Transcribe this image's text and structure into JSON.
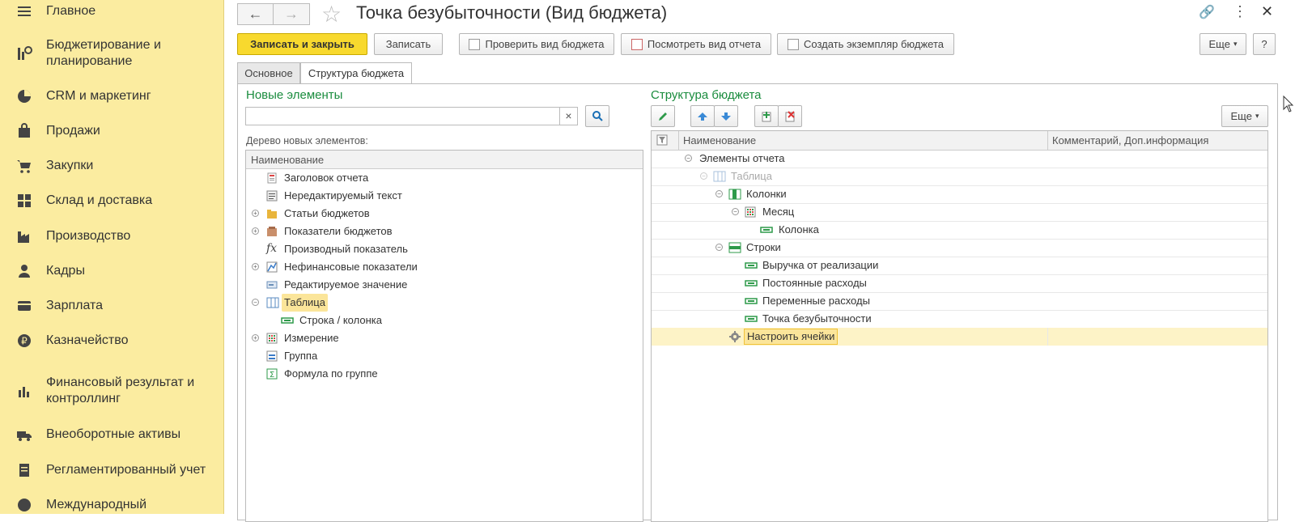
{
  "sidebar": {
    "items": [
      {
        "label": "Главное",
        "icon": "menu-icon"
      },
      {
        "label": "Бюджетирование и планирование",
        "icon": "budget-icon"
      },
      {
        "label": "CRM и маркетинг",
        "icon": "pie-chart-icon"
      },
      {
        "label": "Продажи",
        "icon": "shopping-bag-icon"
      },
      {
        "label": "Закупки",
        "icon": "cart-icon"
      },
      {
        "label": "Склад и доставка",
        "icon": "grid-icon"
      },
      {
        "label": "Производство",
        "icon": "factory-icon"
      },
      {
        "label": "Кадры",
        "icon": "person-icon"
      },
      {
        "label": "Зарплата",
        "icon": "wallet-icon"
      },
      {
        "label": "Казначейство",
        "icon": "ruble-icon"
      },
      {
        "label": "Финансовый результат и контроллинг",
        "icon": "bar-chart-icon"
      },
      {
        "label": "Внеоборотные активы",
        "icon": "truck-icon"
      },
      {
        "label": "Регламентированный учет",
        "icon": "document-icon"
      },
      {
        "label": "Международный",
        "icon": "globe-icon"
      }
    ]
  },
  "header": {
    "title": "Точка безубыточности (Вид бюджета)",
    "back_icon": "←",
    "forward_icon": "→",
    "star_icon": "☆",
    "link_icon": "🔗",
    "more_icon": "⋮",
    "close_icon": "✕"
  },
  "toolbar": {
    "save_close": "Записать и закрыть",
    "save": "Записать",
    "check": "Проверить вид бюджета",
    "view_report": "Посмотреть вид отчета",
    "create_instance": "Создать экземпляр бюджета",
    "more": "Еще",
    "help": "?"
  },
  "tabs": {
    "main": "Основное",
    "structure": "Структура бюджета"
  },
  "left": {
    "title": "Новые элементы",
    "search_value": "",
    "clear": "×",
    "tree_label": "Дерево новых элементов:",
    "column": "Наименование",
    "rows": [
      {
        "label": "Заголовок отчета"
      },
      {
        "label": "Нередактируемый текст"
      },
      {
        "label": "Статьи бюджетов",
        "expand": "+"
      },
      {
        "label": "Показатели бюджетов",
        "expand": "+"
      },
      {
        "label": "Производный показатель",
        "icon_text": "fx"
      },
      {
        "label": "Нефинансовые показатели",
        "expand": "+"
      },
      {
        "label": "Редактируемое значение"
      },
      {
        "label": "Таблица",
        "expand": "−"
      },
      {
        "label": "Строка / колонка"
      },
      {
        "label": "Измерение",
        "expand": "+"
      },
      {
        "label": "Группа"
      },
      {
        "label": "Формула по группе"
      }
    ]
  },
  "right": {
    "title": "Структура бюджета",
    "more": "Еще",
    "col_name": "Наименование",
    "col_comment": "Комментарий, Доп.информация",
    "rows": [
      {
        "label": "Элементы отчета",
        "expand": "−"
      },
      {
        "label": "Таблица",
        "expand": "−"
      },
      {
        "label": "Колонки",
        "expand": "−"
      },
      {
        "label": "Месяц",
        "expand": "−"
      },
      {
        "label": "Колонка"
      },
      {
        "label": "Строки",
        "expand": "−"
      },
      {
        "label": "Выручка от реализации"
      },
      {
        "label": "Постоянные расходы"
      },
      {
        "label": "Переменные расходы"
      },
      {
        "label": "Точка безубыточности"
      },
      {
        "label": "Настроить ячейки"
      }
    ]
  },
  "colors": {
    "accent": "#f8d92e",
    "sidebar": "#fbeca0",
    "section_title": "#1a8c3e",
    "highlight": "#fdf3c7"
  }
}
